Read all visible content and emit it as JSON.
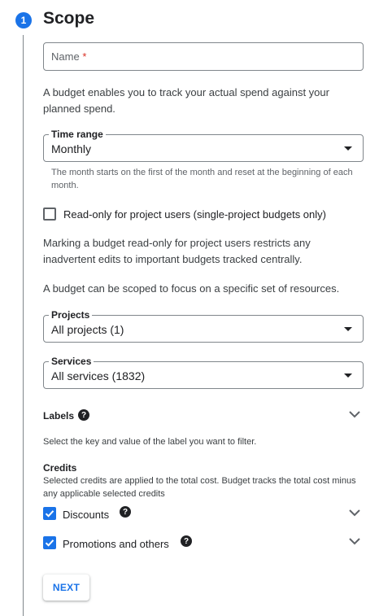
{
  "step": {
    "number": "1",
    "title": "Scope"
  },
  "name_field": {
    "placeholder": "Name",
    "required_marker": "*"
  },
  "budget_intro": "A budget enables you to track your actual spend against your planned spend.",
  "time_range": {
    "label": "Time range",
    "value": "Monthly",
    "helper": "The month starts on the first of the month and reset at the beginning of each month."
  },
  "read_only": {
    "label": "Read-only for project users (single-project budgets only)",
    "checked": false
  },
  "read_only_note": "Marking a budget read-only for project users restricts any inadvertent edits to important budgets tracked centrally.",
  "scope_note": "A budget can be scoped to focus on a specific set of resources.",
  "projects": {
    "label": "Projects",
    "value": "All projects (1)"
  },
  "services": {
    "label": "Services",
    "value": "All services (1832)"
  },
  "labels": {
    "title": "Labels",
    "help_glyph": "?",
    "description": "Select the key and value of the label you want to filter."
  },
  "credits": {
    "title": "Credits",
    "description": "Selected credits are applied to the total cost. Budget tracks the total cost minus any applicable selected credits",
    "items": [
      {
        "label": "Discounts",
        "checked": true,
        "help_glyph": "?"
      },
      {
        "label": "Promotions and others",
        "checked": true,
        "help_glyph": "?"
      }
    ]
  },
  "next_button": "NEXT",
  "colors": {
    "accent": "#1a73e8",
    "text": "#202124",
    "secondary_text": "#5f6368",
    "required": "#d93025"
  },
  "icons": {
    "dropdown": "caret-down-icon",
    "expand": "chevron-down-icon",
    "help": "help-circle-icon",
    "check": "check-icon"
  }
}
